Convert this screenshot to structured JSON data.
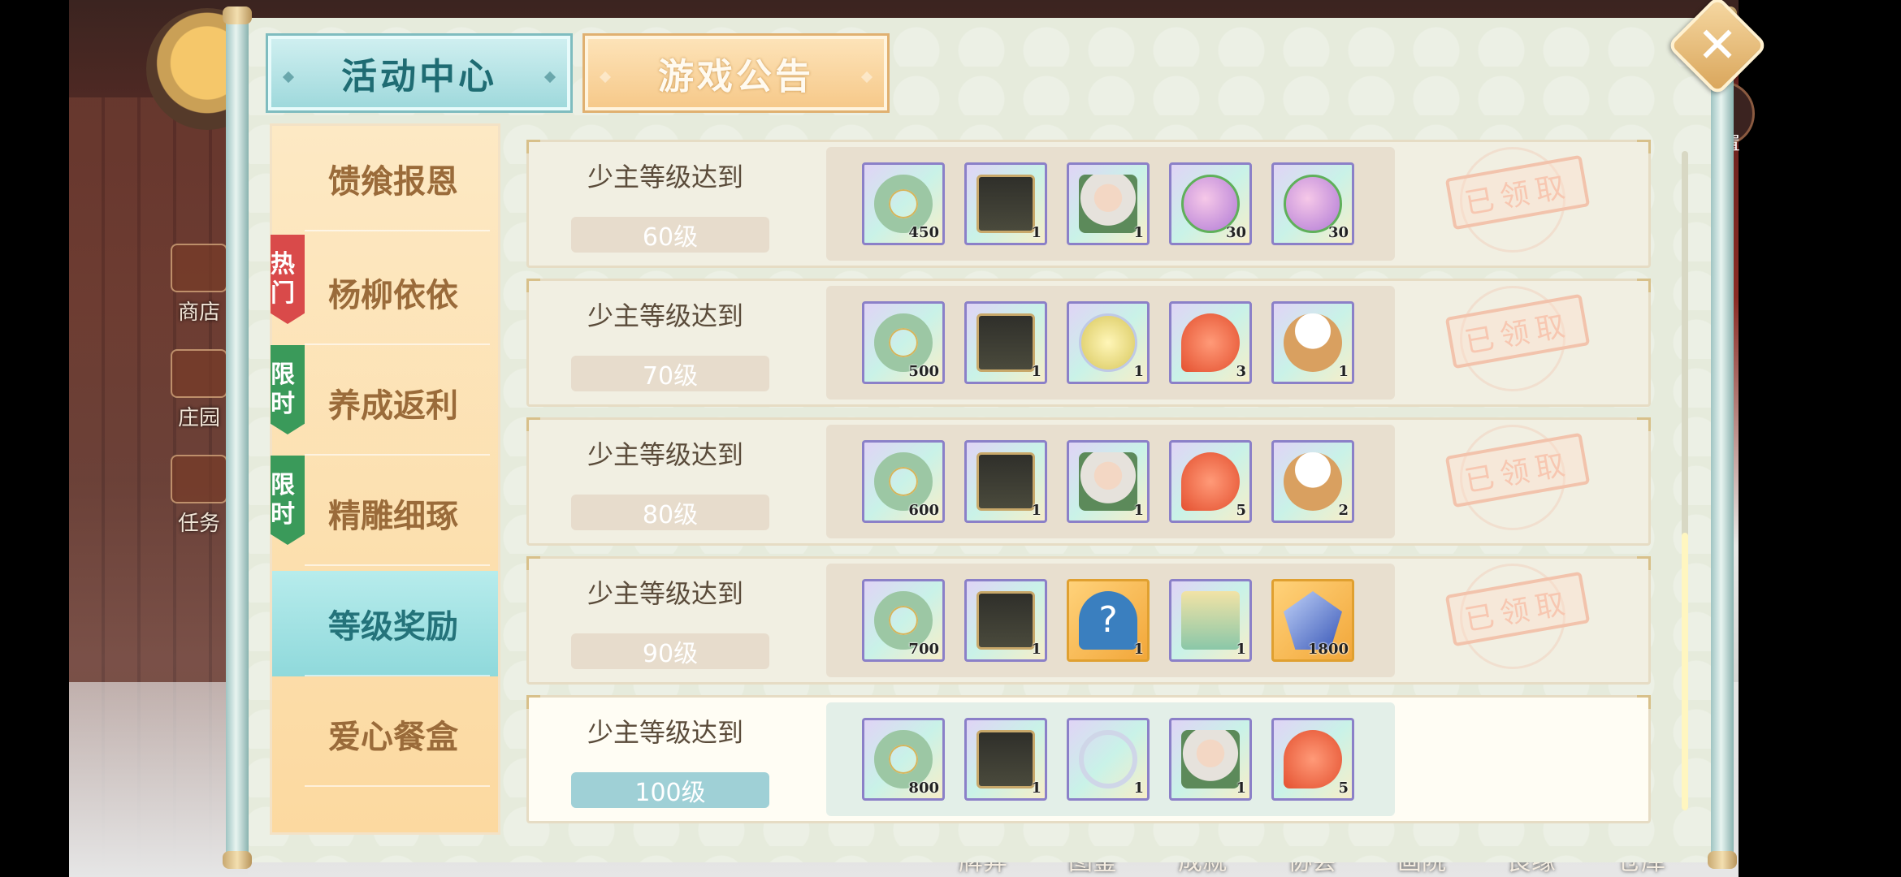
{
  "scene": {
    "side_buttons": [
      "商店",
      "庄园",
      "任务"
    ],
    "bottom_nav": [
      "牌弈",
      "图鉴",
      "成就",
      "协会",
      "画院",
      "良缘",
      "仓库"
    ],
    "top_right_label": "设置"
  },
  "tabs": {
    "active": "活动中心",
    "inactive": "游戏公告"
  },
  "close_label": "✕",
  "menu": {
    "items": [
      {
        "label": "馈飨报恩",
        "badge": ""
      },
      {
        "label": "杨柳依依",
        "badge": "热门",
        "badge_color": "#d94a4a"
      },
      {
        "label": "养成返利",
        "badge": "限时",
        "badge_color": "#3a9a5a"
      },
      {
        "label": "精雕细琢",
        "badge": "限时",
        "badge_color": "#3a9a5a"
      },
      {
        "label": "等级奖励",
        "badge": "",
        "selected": true
      },
      {
        "label": "爱心餐盒",
        "badge": ""
      }
    ]
  },
  "rows": [
    {
      "condition": "少主等级达到",
      "level": "60级",
      "status": "已领取",
      "items": [
        {
          "icon": "jade-ring",
          "count": "450"
        },
        {
          "icon": "treasure-box",
          "count": "1"
        },
        {
          "icon": "character-portrait",
          "count": "1"
        },
        {
          "icon": "pink-egg",
          "count": "30"
        },
        {
          "icon": "pink-egg",
          "count": "30"
        }
      ]
    },
    {
      "condition": "少主等级达到",
      "level": "70级",
      "status": "已领取",
      "items": [
        {
          "icon": "jade-ring",
          "count": "500"
        },
        {
          "icon": "treasure-box",
          "count": "1"
        },
        {
          "icon": "golden-bead",
          "count": "1"
        },
        {
          "icon": "flame-charm",
          "count": "3"
        },
        {
          "icon": "steamed-bun",
          "count": "1"
        }
      ]
    },
    {
      "condition": "少主等级达到",
      "level": "80级",
      "status": "已领取",
      "items": [
        {
          "icon": "jade-ring",
          "count": "600"
        },
        {
          "icon": "treasure-box",
          "count": "1"
        },
        {
          "icon": "character-portrait",
          "count": "1"
        },
        {
          "icon": "flame-charm",
          "count": "5"
        },
        {
          "icon": "steamed-bun",
          "count": "2"
        }
      ]
    },
    {
      "condition": "少主等级达到",
      "level": "90级",
      "status": "已领取",
      "items": [
        {
          "icon": "jade-ring",
          "count": "700"
        },
        {
          "icon": "treasure-box",
          "count": "1"
        },
        {
          "icon": "mystery-character",
          "count": "1",
          "rare": true
        },
        {
          "icon": "ticket-scroll",
          "count": "1"
        },
        {
          "icon": "blue-gem",
          "count": "1800",
          "rare": true
        }
      ]
    },
    {
      "condition": "少主等级达到",
      "level": "100级",
      "status": "",
      "current": true,
      "items": [
        {
          "icon": "jade-ring",
          "count": "800"
        },
        {
          "icon": "treasure-box",
          "count": "1"
        },
        {
          "icon": "silver-bracelet",
          "count": "1"
        },
        {
          "icon": "character-portrait",
          "count": "1"
        },
        {
          "icon": "flame-charm",
          "count": "5"
        }
      ]
    }
  ]
}
